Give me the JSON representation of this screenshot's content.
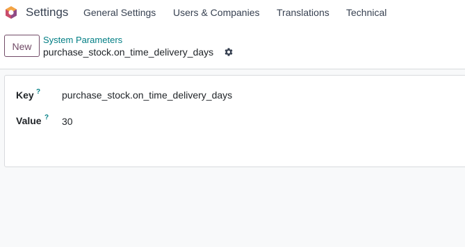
{
  "navbar": {
    "app_title": "Settings",
    "menu": [
      {
        "label": "General Settings"
      },
      {
        "label": "Users & Companies"
      },
      {
        "label": "Translations"
      },
      {
        "label": "Technical"
      }
    ]
  },
  "control_panel": {
    "new_button_label": "New",
    "breadcrumb_parent": "System Parameters",
    "breadcrumb_current": "purchase_stock.on_time_delivery_days"
  },
  "form": {
    "fields": [
      {
        "label": "Key",
        "help": "?",
        "value": "purchase_stock.on_time_delivery_days"
      },
      {
        "label": "Value",
        "help": "?",
        "value": "30"
      }
    ]
  },
  "colors": {
    "brand": "#714b67",
    "link": "#017e84",
    "background": "#f8f9fa"
  },
  "icons": {
    "app_logo": "odoo-settings-logo-icon",
    "actions": "gear-icon"
  }
}
